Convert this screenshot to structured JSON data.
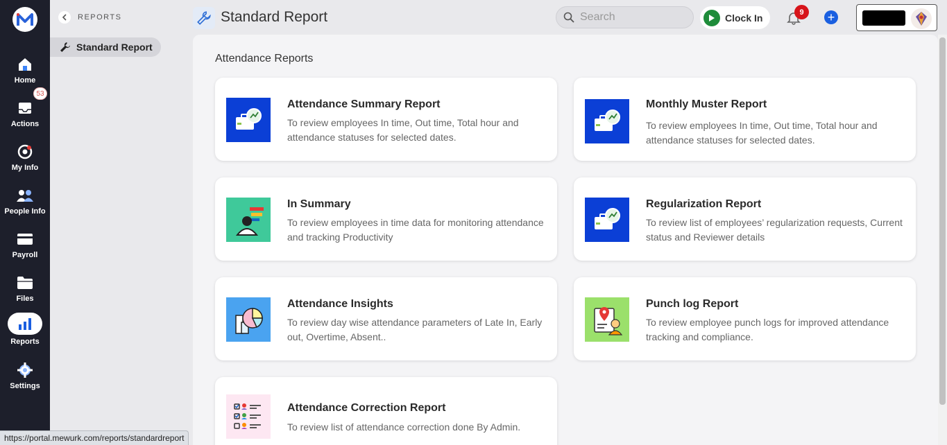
{
  "nav": {
    "items": [
      {
        "label": "Home",
        "icon": "home-icon"
      },
      {
        "label": "Actions",
        "icon": "inbox-icon",
        "badge": "53"
      },
      {
        "label": "My Info",
        "icon": "person-gear-icon"
      },
      {
        "label": "People Info",
        "icon": "people-icon"
      },
      {
        "label": "Payroll",
        "icon": "card-icon"
      },
      {
        "label": "Files",
        "icon": "folder-icon"
      },
      {
        "label": "Reports",
        "icon": "bar-chart-icon",
        "active": true
      },
      {
        "label": "Settings",
        "icon": "gear-icon"
      }
    ]
  },
  "subnav": {
    "title": "REPORTS",
    "item": "Standard Report"
  },
  "header": {
    "title": "Standard Report",
    "search_placeholder": "Search",
    "clock_in": "Clock In",
    "notification_count": "9"
  },
  "main": {
    "section_title": "Attendance Reports",
    "cards": [
      {
        "title": "Attendance Summary Report",
        "desc": "To review employees In time, Out time, Total hour and attendance statuses for selected dates.",
        "icon": "briefcase-chart-icon"
      },
      {
        "title": "Monthly Muster Report",
        "desc": "To review employees In time, Out time, Total hour and attendance statuses for selected dates.",
        "icon": "briefcase-chart-icon"
      },
      {
        "title": "In Summary",
        "desc": "To review employees in time data for monitoring attendance and tracking Productivity",
        "icon": "person-list-icon"
      },
      {
        "title": "Regularization Report",
        "desc": "To review list of employees’ regularization requests, Current status and Reviewer details",
        "icon": "briefcase-chart-icon"
      },
      {
        "title": "Attendance Insights",
        "desc": "To review day wise attendance parameters of Late In, Early out, Overtime, Absent..",
        "icon": "pie-bar-icon"
      },
      {
        "title": "Punch log Report",
        "desc": "To review employee punch logs for improved attendance tracking and compliance.",
        "icon": "location-person-icon"
      },
      {
        "title": "Attendance Correction Report",
        "desc": "To review list of attendance correction done By Admin.",
        "icon": "checklist-people-icon"
      }
    ]
  },
  "status_url": "https://portal.mewurk.com/reports/standardreport",
  "colors": {
    "nav_bg": "#1d1f2b",
    "accent_blue": "#0b3fd6",
    "clock_green": "#1e8c3a",
    "badge_red": "#d7141a"
  }
}
